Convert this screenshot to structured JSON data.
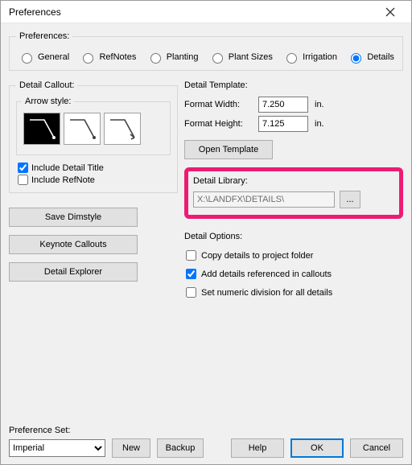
{
  "window": {
    "title": "Preferences"
  },
  "group_preferences": {
    "legend": "Preferences:",
    "options": {
      "general": "General",
      "refnotes": "RefNotes",
      "planting": "Planting",
      "plant_sizes": "Plant Sizes",
      "irrigation": "Irrigation",
      "details": "Details"
    },
    "selected": "details"
  },
  "detail_callout": {
    "legend": "Detail Callout:",
    "arrow_style_legend": "Arrow style:",
    "include_detail_title": "Include Detail Title",
    "include_refnote": "Include RefNote"
  },
  "left_buttons": {
    "save_dimstyle": "Save Dimstyle",
    "keynote_callouts": "Keynote Callouts",
    "detail_explorer": "Detail Explorer"
  },
  "detail_template": {
    "label": "Detail Template:",
    "format_width_label": "Format Width:",
    "format_width_value": "7.250",
    "format_height_label": "Format Height:",
    "format_height_value": "7.125",
    "unit": "in.",
    "open_template": "Open Template"
  },
  "detail_library": {
    "label": "Detail Library:",
    "path": "X:\\LANDFX\\DETAILS\\",
    "browse": "..."
  },
  "detail_options": {
    "label": "Detail Options:",
    "copy_to_folder": "Copy details to project folder",
    "add_referenced": "Add details referenced in callouts",
    "set_numeric": "Set numeric division for all details"
  },
  "pref_set": {
    "label": "Preference Set:",
    "value": "Imperial",
    "new": "New",
    "backup": "Backup"
  },
  "footer": {
    "help": "Help",
    "ok": "OK",
    "cancel": "Cancel"
  }
}
